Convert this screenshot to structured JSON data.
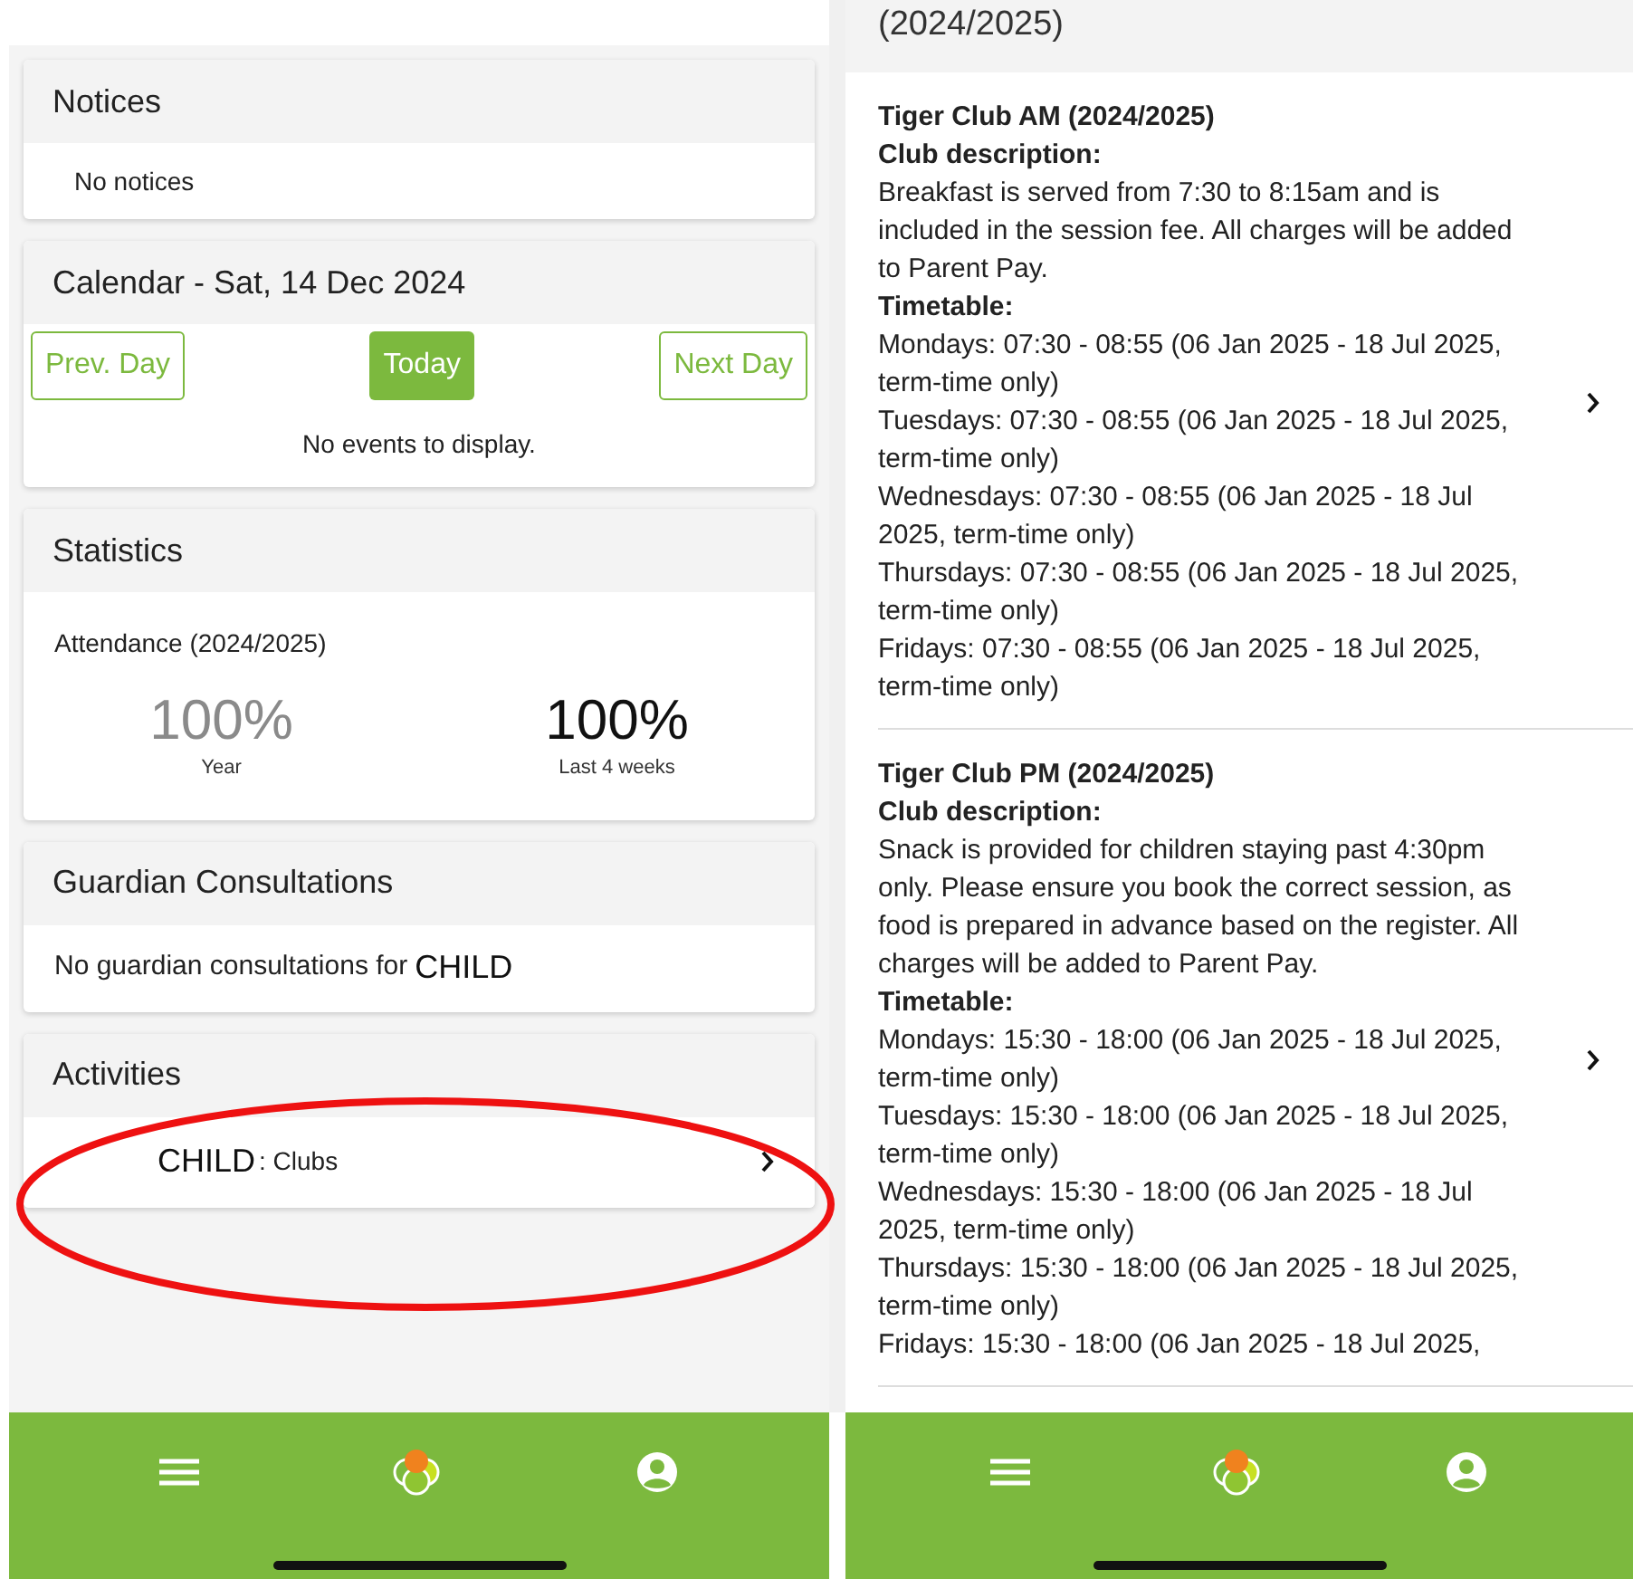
{
  "left_screen": {
    "notices": {
      "title": "Notices",
      "message": "No notices"
    },
    "calendar": {
      "title": "Calendar - Sat, 14 Dec 2024",
      "buttons": [
        {
          "label": "Prev. Day",
          "selected": false
        },
        {
          "label": "Today",
          "selected": true
        },
        {
          "label": "Next Day",
          "selected": false
        }
      ],
      "message": "No events to display."
    },
    "statistics": {
      "title": "Statistics",
      "subtitle": "Attendance (2024/2025)",
      "stats": [
        {
          "value": "100%",
          "label": "Year",
          "muted": true
        },
        {
          "value": "100%",
          "label": "Last 4 weeks",
          "muted": false
        }
      ]
    },
    "consultations": {
      "title": "Guardian Consultations",
      "message": "No guardian consultations for",
      "child": "CHILD"
    },
    "activities": {
      "title": "Activities",
      "items": [
        {
          "child": "CHILD",
          "label": ": Clubs"
        }
      ]
    }
  },
  "right_screen": {
    "header": "(2024/2025)",
    "clubs": [
      {
        "title": "Tiger Club AM (2024/2025)",
        "description_label": "Club description:",
        "description": "Breakfast is served from 7:30 to 8:15am and is included in the session fee. All charges will be added to Parent Pay.",
        "timetable_label": "Timetable:",
        "timetable": [
          "Mondays: 07:30 - 08:55 (06 Jan 2025 - 18 Jul 2025, term-time only)",
          "Tuesdays: 07:30 - 08:55 (06 Jan 2025 - 18 Jul 2025, term-time only)",
          "Wednesdays: 07:30 - 08:55 (06 Jan 2025 - 18 Jul 2025, term-time only)",
          "Thursdays: 07:30 - 08:55 (06 Jan 2025 - 18 Jul 2025, term-time only)",
          "Fridays: 07:30 - 08:55 (06 Jan 2025 - 18 Jul 2025, term-time only)"
        ]
      },
      {
        "title": "Tiger Club PM (2024/2025)",
        "description_label": "Club description:",
        "description": "Snack is provided for children staying past 4:30pm only. Please ensure you book the correct session, as food is prepared in advance based on the register. All charges will be added to Parent Pay.",
        "timetable_label": "Timetable:",
        "timetable": [
          "Mondays: 15:30 - 18:00 (06 Jan 2025 - 18 Jul 2025, term-time only)",
          "Tuesdays: 15:30 - 18:00 (06 Jan 2025 - 18 Jul 2025, term-time only)",
          "Wednesdays: 15:30 - 18:00 (06 Jan 2025 - 18 Jul 2025, term-time only)",
          "Thursdays: 15:30 - 18:00 (06 Jan 2025 - 18 Jul 2025, term-time only)",
          "Fridays: 15:30 - 18:00 (06 Jan 2025 - 18 Jul 2025,"
        ]
      }
    ]
  }
}
